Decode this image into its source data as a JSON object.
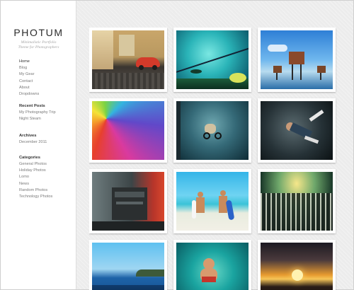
{
  "site": {
    "title": "PHOTUM",
    "tagline_line1": "Minimalistic Portfolio",
    "tagline_line2": "Theme for Photographers"
  },
  "nav": {
    "items": [
      {
        "label": "Home"
      },
      {
        "label": "Blog"
      },
      {
        "label": "My Gear"
      },
      {
        "label": "Contact"
      },
      {
        "label": "About"
      },
      {
        "label": "Dropdowns"
      }
    ]
  },
  "recent_posts": {
    "title": "Recent Posts",
    "items": [
      {
        "label": "My Photography Trip"
      },
      {
        "label": "Night Steam"
      }
    ]
  },
  "archives": {
    "title": "Archives",
    "items": [
      {
        "label": "December 2011"
      }
    ]
  },
  "categories": {
    "title": "Categories",
    "items": [
      {
        "label": "General Photos"
      },
      {
        "label": "Holiday Photos"
      },
      {
        "label": "Lomo"
      },
      {
        "label": "News"
      },
      {
        "label": "Random Photos"
      },
      {
        "label": "Technology Photos"
      }
    ]
  },
  "gallery": {
    "photos": [
      {
        "subject": "red-car-street"
      },
      {
        "subject": "teal-wire-sky"
      },
      {
        "subject": "sea-fort-towers"
      },
      {
        "subject": "rainbow-umbrella"
      },
      {
        "subject": "cyclist-topdown"
      },
      {
        "subject": "breakdancer"
      },
      {
        "subject": "printing-press"
      },
      {
        "subject": "beach-surfers"
      },
      {
        "subject": "mixing-console"
      },
      {
        "subject": "coast-seascape"
      },
      {
        "subject": "swimmer-pool"
      },
      {
        "subject": "sunset-sea"
      }
    ]
  }
}
